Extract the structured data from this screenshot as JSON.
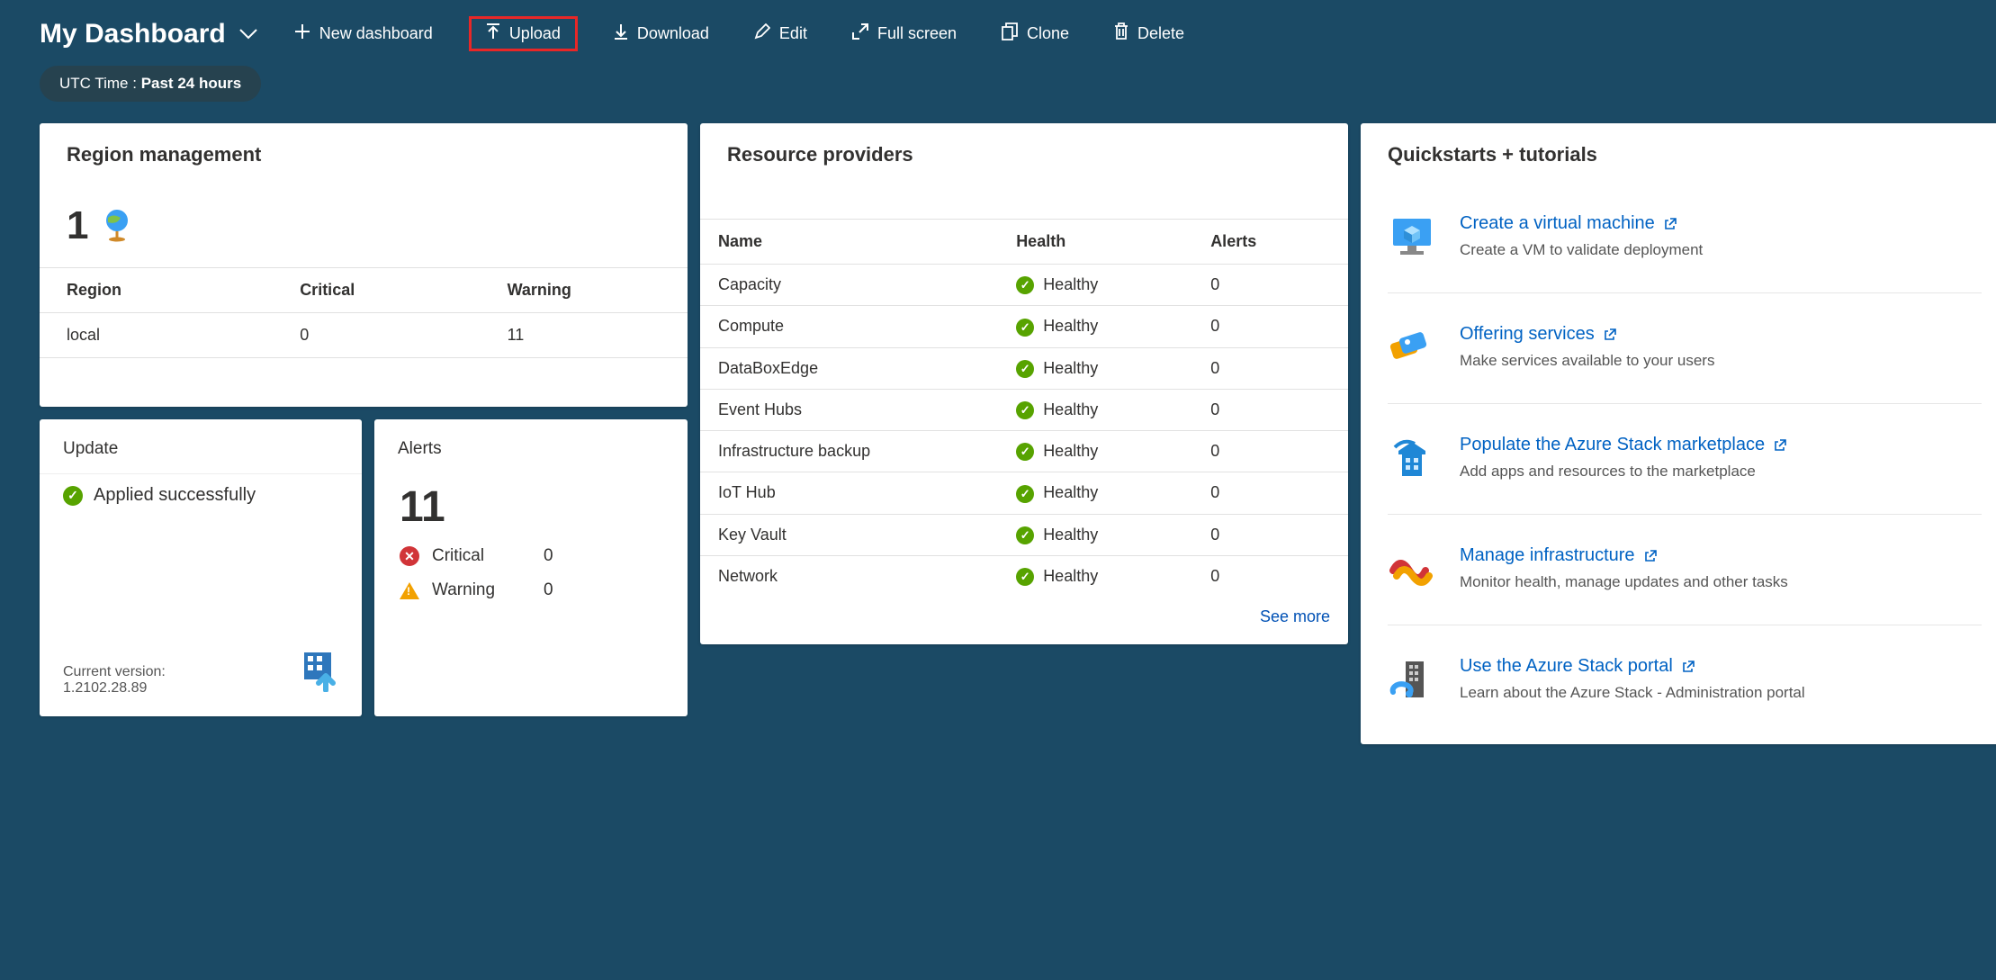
{
  "header": {
    "title": "My Dashboard",
    "toolbar": {
      "new_dashboard": "New dashboard",
      "upload": "Upload",
      "download": "Download",
      "edit": "Edit",
      "fullscreen": "Full screen",
      "clone": "Clone",
      "delete": "Delete"
    },
    "time_pill_label": "UTC Time :",
    "time_pill_value": "Past 24 hours"
  },
  "region_mgmt": {
    "title": "Region management",
    "count": "1",
    "columns": {
      "c1": "Region",
      "c2": "Critical",
      "c3": "Warning"
    },
    "rows": [
      {
        "region": "local",
        "critical": "0",
        "warning": "11"
      }
    ]
  },
  "update_card": {
    "title": "Update",
    "status": "Applied successfully",
    "version_label": "Current version:",
    "version": "1.2102.28.89"
  },
  "alerts_card": {
    "title": "Alerts",
    "count": "11",
    "critical_label": "Critical",
    "critical_val": "0",
    "warning_label": "Warning",
    "warning_val": "0"
  },
  "resource_providers": {
    "title": "Resource providers",
    "columns": {
      "c1": "Name",
      "c2": "Health",
      "c3": "Alerts"
    },
    "rows": [
      {
        "name": "Capacity",
        "health": "Healthy",
        "alerts": "0"
      },
      {
        "name": "Compute",
        "health": "Healthy",
        "alerts": "0"
      },
      {
        "name": "DataBoxEdge",
        "health": "Healthy",
        "alerts": "0"
      },
      {
        "name": "Event Hubs",
        "health": "Healthy",
        "alerts": "0"
      },
      {
        "name": "Infrastructure backup",
        "health": "Healthy",
        "alerts": "0"
      },
      {
        "name": "IoT Hub",
        "health": "Healthy",
        "alerts": "0"
      },
      {
        "name": "Key Vault",
        "health": "Healthy",
        "alerts": "0"
      },
      {
        "name": "Network",
        "health": "Healthy",
        "alerts": "0"
      }
    ],
    "see_more": "See more"
  },
  "quickstarts": {
    "title": "Quickstarts + tutorials",
    "items": [
      {
        "title": "Create a virtual machine",
        "desc": "Create a VM to validate deployment"
      },
      {
        "title": "Offering services",
        "desc": "Make services available to your users"
      },
      {
        "title": "Populate the Azure Stack marketplace",
        "desc": "Add apps and resources to the marketplace"
      },
      {
        "title": "Manage infrastructure",
        "desc": "Monitor health, manage updates and other tasks"
      },
      {
        "title": "Use the Azure Stack portal",
        "desc": "Learn about the Azure Stack - Administration portal"
      }
    ]
  }
}
